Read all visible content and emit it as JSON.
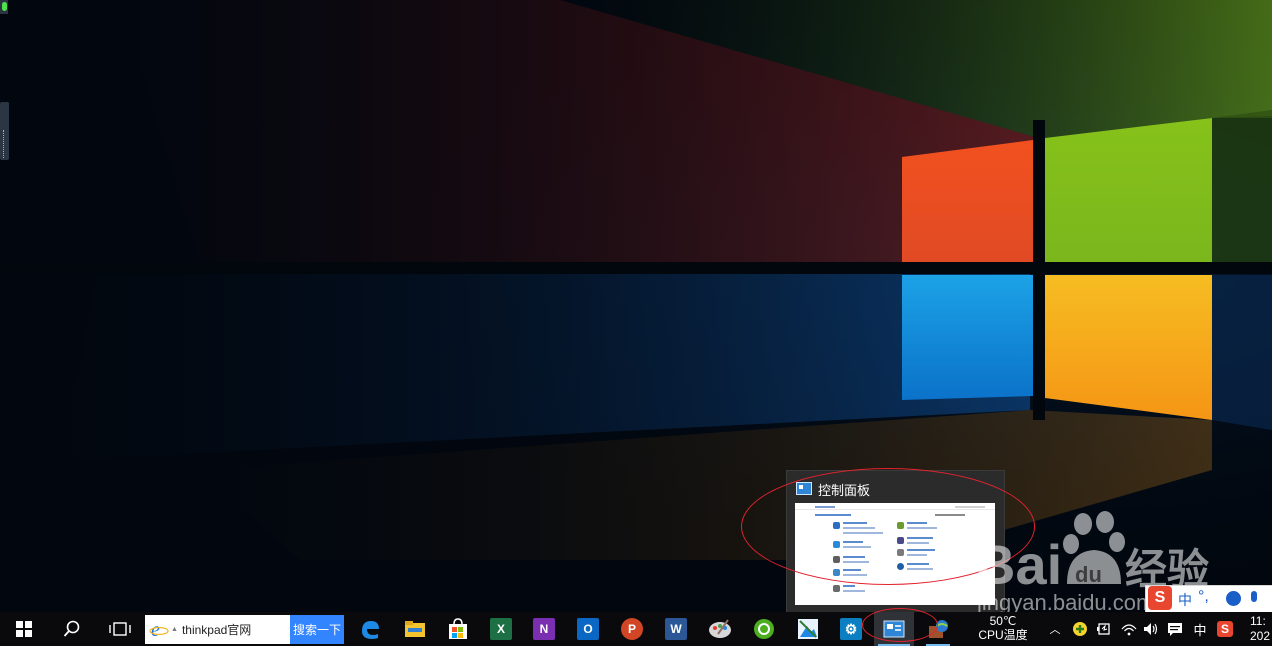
{
  "thumbnail": {
    "title": "控制面板"
  },
  "taskbar": {
    "search_text": "thinkpad官网",
    "search_button_label": "搜索一下",
    "cpu_temp_value": "50℃",
    "cpu_temp_label": "CPU温度",
    "ime_label": "中",
    "clock_time": "11:",
    "clock_date": "202"
  },
  "watermark": {
    "text_main": "Bai",
    "text_du": "du",
    "text_cn": "经验",
    "url": "jingyan.baidu.com"
  },
  "icons": [
    "start-icon",
    "search-icon",
    "task-view-icon",
    "ie-icon",
    "edge-icon",
    "file-explorer-icon",
    "store-icon",
    "excel-icon",
    "onenote-icon",
    "outlook-icon",
    "powerpoint-icon",
    "word-icon",
    "paint-icon",
    "green-app-icon",
    "photo-app-icon",
    "settings-icon",
    "control-panel-icon",
    "network-app-icon"
  ]
}
